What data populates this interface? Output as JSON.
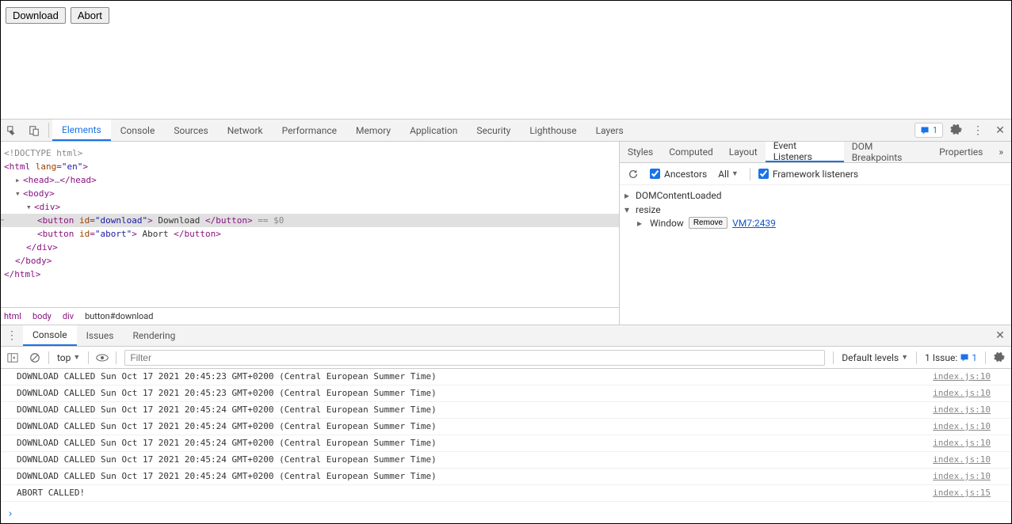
{
  "page": {
    "download_label": "Download",
    "abort_label": "Abort"
  },
  "devtools": {
    "tabs": [
      "Elements",
      "Console",
      "Sources",
      "Network",
      "Performance",
      "Memory",
      "Application",
      "Security",
      "Lighthouse",
      "Layers"
    ],
    "active_tab": "Elements",
    "issue_count": "1"
  },
  "dom": {
    "doctype": "<!DOCTYPE html>",
    "html_open": "html",
    "html_lang_attr": "lang",
    "html_lang_val": "\"en\"",
    "head_open": "head",
    "head_ellipsis": "…",
    "head_close": "head",
    "body_open": "body",
    "div_open": "div",
    "btn1_tag": "button",
    "btn1_attr": "id",
    "btn1_val": "\"download\"",
    "btn1_text": " Download ",
    "btn1_ref": " == $0",
    "btn2_tag": "button",
    "btn2_attr": "id",
    "btn2_val": "\"abort\"",
    "btn2_text": " Abort ",
    "div_close": "div",
    "body_close": "body",
    "html_close": "html"
  },
  "breadcrumb": {
    "items": [
      "html",
      "body",
      "div",
      "button#download"
    ]
  },
  "sidebar": {
    "tabs": [
      "Styles",
      "Computed",
      "Layout",
      "Event Listeners",
      "DOM Breakpoints",
      "Properties"
    ],
    "active_tab": "Event Listeners",
    "ancestors_label": "Ancestors",
    "ancestors_checked": true,
    "scope": "All",
    "framework_label": "Framework listeners",
    "framework_checked": true,
    "events": {
      "item0": "DOMContentLoaded",
      "item1": "resize",
      "target": "Window",
      "remove_label": "Remove",
      "vm_link": "VM7:2439"
    }
  },
  "drawer": {
    "tabs": [
      "Console",
      "Issues",
      "Rendering"
    ],
    "active_tab": "Console",
    "context": "top",
    "filter_placeholder": "Filter",
    "levels": "Default levels",
    "issue_label": "1 Issue:",
    "issue_count": "1"
  },
  "console": {
    "rows": [
      {
        "msg": "DOWNLOAD CALLED Sun Oct 17 2021 20:45:23 GMT+0200 (Central European Summer Time)",
        "src": "index.js:10"
      },
      {
        "msg": "DOWNLOAD CALLED Sun Oct 17 2021 20:45:23 GMT+0200 (Central European Summer Time)",
        "src": "index.js:10"
      },
      {
        "msg": "DOWNLOAD CALLED Sun Oct 17 2021 20:45:24 GMT+0200 (Central European Summer Time)",
        "src": "index.js:10"
      },
      {
        "msg": "DOWNLOAD CALLED Sun Oct 17 2021 20:45:24 GMT+0200 (Central European Summer Time)",
        "src": "index.js:10"
      },
      {
        "msg": "DOWNLOAD CALLED Sun Oct 17 2021 20:45:24 GMT+0200 (Central European Summer Time)",
        "src": "index.js:10"
      },
      {
        "msg": "DOWNLOAD CALLED Sun Oct 17 2021 20:45:24 GMT+0200 (Central European Summer Time)",
        "src": "index.js:10"
      },
      {
        "msg": "DOWNLOAD CALLED Sun Oct 17 2021 20:45:24 GMT+0200 (Central European Summer Time)",
        "src": "index.js:10"
      },
      {
        "msg": "ABORT CALLED!",
        "src": "index.js:15"
      }
    ]
  }
}
